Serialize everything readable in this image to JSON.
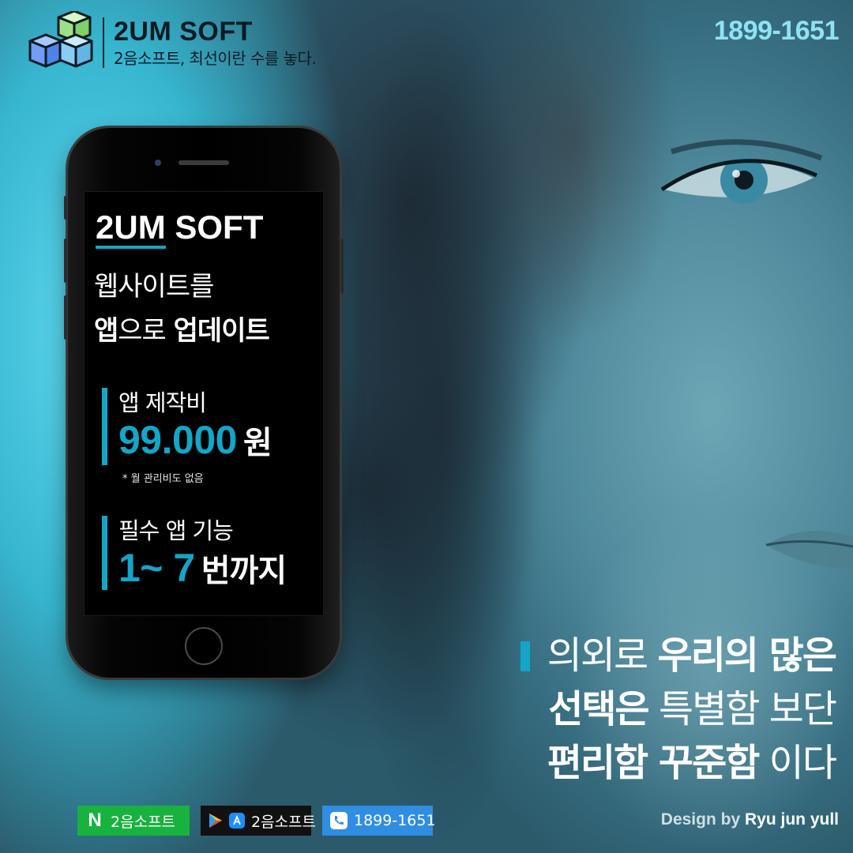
{
  "brand": {
    "title": "2UM SOFT",
    "tagline": "2음소프트, 최선이란 수를 놓다."
  },
  "top_phone_number": "1899-1651",
  "phone_screen": {
    "brand_underlined": "2UM",
    "brand_rest": "SOFT",
    "headline_line1": "웹사이트를",
    "headline_line2_bold1": "앱",
    "headline_line2_normal": "으로",
    "headline_line2_bold2": "업데이트",
    "price_label": "앱 제작비",
    "price_value": "99.000",
    "price_unit": "원",
    "price_note": "* 월 관리비도 없음",
    "feature_label": "필수 앱 기능",
    "feature_value": "1~ 7",
    "feature_unit": "번까지"
  },
  "quote": {
    "line1_normal": "의외로",
    "line1_bold": "우리의 많은",
    "line2_bold": "선택은",
    "line2_normal": "특별함 보단",
    "line3_bold": "편리함 꾸준함",
    "line3_normal": "이다"
  },
  "badges": [
    {
      "icon": "naver-n-icon",
      "label": "2음소프트",
      "color": "#18b23f"
    },
    {
      "icon": "app-store-icons",
      "label": "2음소프트",
      "color": "#111111"
    },
    {
      "icon": "phone-call-icon",
      "label": "1899-1651",
      "color": "#2f8de2"
    }
  ],
  "credit": {
    "prefix": "Design by",
    "author": "Ryu jun yull"
  },
  "colors": {
    "accent": "#12a6c8",
    "top_phone": "#8fe3f3"
  }
}
